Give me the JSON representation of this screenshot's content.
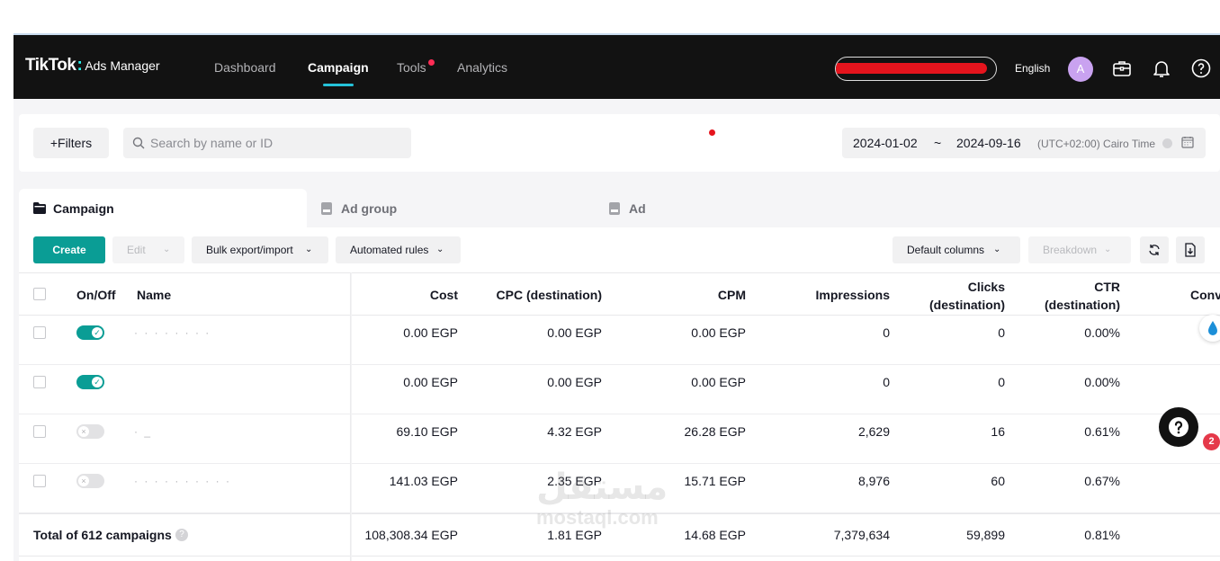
{
  "nav": {
    "logo": "TikTok",
    "logo_sub": "Ads Manager",
    "items": [
      "Dashboard",
      "Campaign",
      "Tools",
      "Analytics"
    ],
    "language": "English",
    "avatar_initial": "A"
  },
  "filters": {
    "filters_label": "+Filters",
    "search_placeholder": "Search by name or ID",
    "date_start": "2024-01-02",
    "date_sep": "~",
    "date_end": "2024-09-16",
    "timezone": "(UTC+02:00) Cairo Time"
  },
  "tabs": [
    "Campaign",
    "Ad group",
    "Ad"
  ],
  "toolbar": {
    "create": "Create",
    "edit": "Edit",
    "bulk": "Bulk export/import",
    "rules": "Automated rules",
    "columns": "Default columns",
    "breakdown": "Breakdown"
  },
  "table": {
    "headers": {
      "onoff": "On/Off",
      "name": "Name",
      "cost": "Cost",
      "cpc": "CPC (destination)",
      "cpm": "CPM",
      "impressions": "Impressions",
      "clicks_1": "Clicks",
      "clicks_2": "(destination)",
      "ctr_1": "CTR",
      "ctr_2": "(destination)",
      "conv": "Conv"
    },
    "rows": [
      {
        "on": true,
        "cost": "0.00 EGP",
        "cpc": "0.00 EGP",
        "cpm": "0.00 EGP",
        "impressions": "0",
        "clicks": "0",
        "ctr": "0.00%"
      },
      {
        "on": true,
        "cost": "0.00 EGP",
        "cpc": "0.00 EGP",
        "cpm": "0.00 EGP",
        "impressions": "0",
        "clicks": "0",
        "ctr": "0.00%"
      },
      {
        "on": false,
        "cost": "69.10 EGP",
        "cpc": "4.32 EGP",
        "cpm": "26.28 EGP",
        "impressions": "2,629",
        "clicks": "16",
        "ctr": "0.61%"
      },
      {
        "on": false,
        "cost": "141.03 EGP",
        "cpc": "2.35 EGP",
        "cpm": "15.71 EGP",
        "impressions": "8,976",
        "clicks": "60",
        "ctr": "0.67%"
      }
    ],
    "total": {
      "label": "Total of 612 campaigns",
      "cost": "108,308.34 EGP",
      "cpc": "1.81 EGP",
      "cpm": "14.68 EGP",
      "impressions": "7,379,634",
      "clicks": "59,899",
      "ctr": "0.81%"
    }
  },
  "help_badge": "2",
  "watermark": {
    "arabic": "مستقل",
    "latin": "mostaql.com"
  },
  "colors": {
    "accent": "#0a9d95",
    "nav_bg": "#121212",
    "alert": "#fe2c55"
  }
}
